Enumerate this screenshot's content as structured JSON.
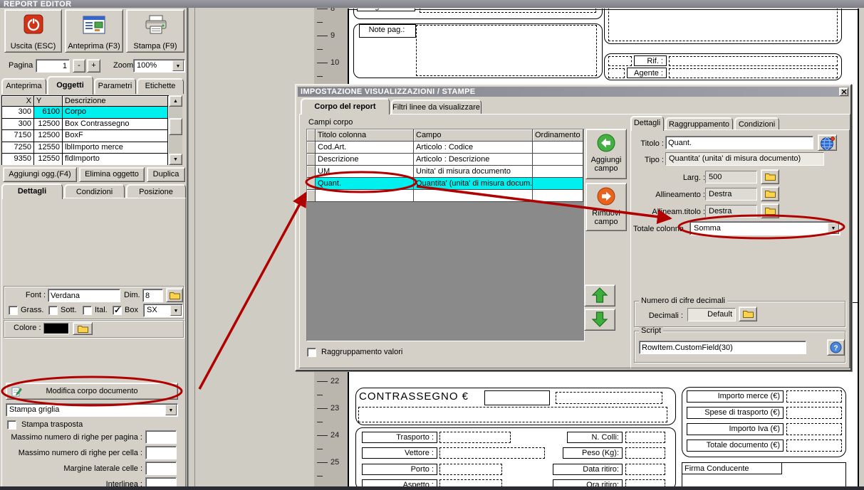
{
  "window_title": "REPORT EDITOR",
  "toolbar": {
    "exit": "Uscita (ESC)",
    "preview": "Anteprima (F3)",
    "print": "Stampa (F9)",
    "page_label": "Pagina",
    "page_value": "1",
    "minus": "-",
    "plus": "+",
    "zoom_label": "Zoom",
    "zoom_value": "100%"
  },
  "main_tabs": {
    "anteprima": "Anteprima",
    "oggetti": "Oggetti",
    "parametri": "Parametri",
    "etichette": "Etichette"
  },
  "objects_grid": {
    "col_x": "X",
    "col_y": "Y",
    "col_desc": "Descrizione",
    "selected_index": 0,
    "rows": [
      {
        "x": "300",
        "y": "6100",
        "desc": "Corpo"
      },
      {
        "x": "300",
        "y": "12500",
        "desc": "Box Contrassegno"
      },
      {
        "x": "7150",
        "y": "12500",
        "desc": "BoxF"
      },
      {
        "x": "7250",
        "y": "12550",
        "desc": "lblImporto merce"
      },
      {
        "x": "9350",
        "y": "12550",
        "desc": "fldImporto"
      }
    ]
  },
  "object_buttons": {
    "add": "Aggiungi ogg.(F4)",
    "delete": "Elimina oggetto",
    "duplicate": "Duplica"
  },
  "detail_tabs": {
    "dettagli": "Dettagli",
    "condizioni": "Condizioni",
    "posizione": "Posizione"
  },
  "font_group": {
    "font_label": "Font :",
    "font_value": "Verdana",
    "dim_label": "Dim.",
    "dim_value": "8",
    "grass": "Grass.",
    "sott": "Sott.",
    "ital": "Ital.",
    "box": "Box",
    "box_checked": true,
    "box_align": "SX"
  },
  "color_row": {
    "label": "Colore :",
    "swatch": "#000000"
  },
  "body_section": {
    "edit_button": "Modifica corpo documento",
    "grid_mode": "Stampa griglia",
    "transposed": "Stampa trasposta",
    "max_rows_page": "Massimo numero di righe per pagina :",
    "max_rows_cell": "Massimo numero di righe per cella :",
    "cell_margin": "Margine laterale celle :",
    "line_spacing": "Interlinea :"
  },
  "dialog": {
    "title": "IMPOSTAZIONE VISUALIZZAZIONI / STAMPE",
    "tab_corpo": "Corpo del report",
    "tab_filtri": "Filtri linee da visualizzare",
    "campi_label": "Campi corpo",
    "table": {
      "col_titolo": "Titolo colonna",
      "col_campo": "Campo",
      "col_ord": "Ordinamento",
      "selected_index": 3,
      "rows": [
        {
          "titolo": "Cod.Art.",
          "campo": "Articolo : Codice"
        },
        {
          "titolo": "Descrizione",
          "campo": "Articolo : Descrizione"
        },
        {
          "titolo": "UM",
          "campo": "Unita' di misura documento"
        },
        {
          "titolo": "Quant.",
          "campo": "Quantita' (unita' di misura docum..."
        }
      ]
    },
    "add_line1": "Aggiungi",
    "add_line2": "campo",
    "remove_line1": "Rimuovi",
    "remove_line2": "campo",
    "grouping": "Raggruppamento valori",
    "right_tabs": {
      "dettagli": "Dettagli",
      "raggruppamento": "Raggruppamento",
      "condizioni": "Condizioni"
    },
    "detail": {
      "titolo_label": "Titolo :",
      "titolo_value": "Quant.",
      "tipo_label": "Tipo :",
      "tipo_value": "Quantita' (unita' di misura documento)",
      "larg_label": "Larg. :",
      "larg_value": "500",
      "all_label": "Allineamento :",
      "all_value": "Destra",
      "allt_label": "Allineam.titolo :",
      "allt_value": "Destra",
      "totale_label": "Totale colonna",
      "totale_value": "Somma"
    },
    "decimals": {
      "title": "Numero di cifre decimali",
      "label": "Decimali :",
      "value": "Default"
    },
    "script": {
      "title": "Script",
      "value": "RowItem.CustomField(30)"
    }
  },
  "preview": {
    "ruler_top": [
      "8",
      "9",
      "10"
    ],
    "ruler_bottom": [
      "22",
      "23",
      "24",
      "25"
    ],
    "pagamento": "Pagamento",
    "note_pag": "Note pag.:",
    "rif": "Rif. :",
    "agente": "Agente :",
    "contrassegno": "CONTRASSEGNO €",
    "trasporto": "Trasporto :",
    "vettore": "Vettore :",
    "porto": "Porto :",
    "aspetto": "Aspetto :",
    "n_colli": "N. Colli:",
    "peso": "Peso (Kg):",
    "data_ritiro": "Data ritiro:",
    "ora_ritiro": "Ora ritiro:",
    "importo_merce": "Importo merce (€)",
    "spese_trasporto": "Spese di trasporto (€)",
    "importo_iva": "Importo Iva (€)",
    "totale_documento": "Totale documento (€)",
    "firma": "Firma Conducente"
  },
  "colors": {
    "selection": "#00F0F0",
    "annotation": "#B00000"
  }
}
